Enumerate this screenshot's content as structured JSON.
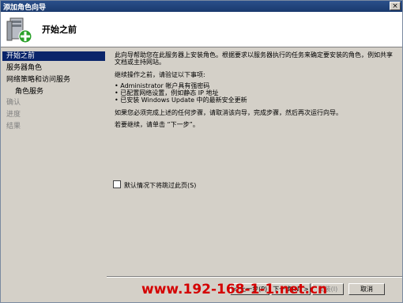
{
  "window": {
    "title": "添加角色向导",
    "close_label": "×"
  },
  "header": {
    "title": "开始之前"
  },
  "sidebar": {
    "items": [
      {
        "label": "开始之前",
        "state": "selected"
      },
      {
        "label": "服务器角色",
        "state": "normal"
      },
      {
        "label": "网络策略和访问服务",
        "state": "normal"
      },
      {
        "label": "角色服务",
        "state": "normal"
      },
      {
        "label": "确认",
        "state": "disabled"
      },
      {
        "label": "进度",
        "state": "disabled"
      },
      {
        "label": "结果",
        "state": "disabled"
      }
    ]
  },
  "main": {
    "intro_line1": "此向导帮助您在此服务器上安装角色。根据要求以服务器执行的任务来确定要安装的角色，例如共享",
    "intro_line2": "文档或主持网站。",
    "verify_heading": "继续操作之前，请验证以下事项:",
    "bullets": [
      "• Administrator 帐户具有强密码",
      "• 已配置网络设置，例如静态 IP 地址",
      "• 已安装 Windows Update 中的最新安全更新"
    ],
    "cancel_note": "如果您必须完成上述的任何步骤，请取消该向导，完成步骤，然后再次运行向导。",
    "continue_note": "若要继续，请单击 “下一步”。",
    "skip_checkbox_label": "默认情况下将跳过此页(S)"
  },
  "buttons": {
    "back": "< 上一步(P)",
    "next": "下一步(N) >",
    "install": "安装(I)",
    "cancel": "取消"
  },
  "watermark": "www.192-168-1-1.net.cn",
  "colors": {
    "selection": "#0a246a",
    "titlebar": "#1a3a6e",
    "watermark": "#d40000"
  }
}
